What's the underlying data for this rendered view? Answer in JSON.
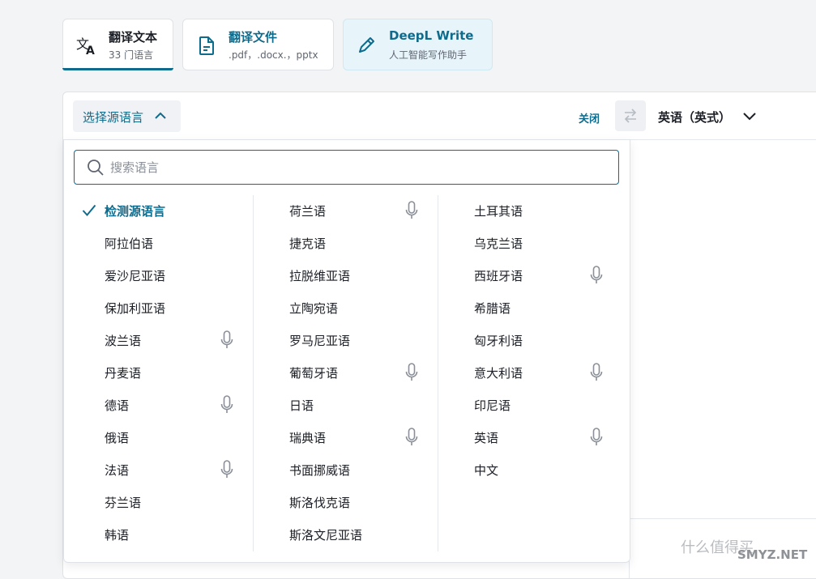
{
  "tabs": [
    {
      "title": "翻译文本",
      "subtitle": "33 门语言",
      "icon": "translate-icon"
    },
    {
      "title": "翻译文件",
      "subtitle": ".pdf，.docx.，pptx",
      "icon": "document-icon"
    },
    {
      "title": "DeepL Write",
      "subtitle": "人工智能写作助手",
      "icon": "pen-icon"
    }
  ],
  "toolbar": {
    "source_button": "选择源语言",
    "close_label": "关闭",
    "target_language": "英语（英式）"
  },
  "search": {
    "placeholder": "搜索语言",
    "value": ""
  },
  "languages": {
    "col1": [
      {
        "label": "检测源语言",
        "selected": true,
        "mic": false
      },
      {
        "label": "阿拉伯语",
        "mic": false
      },
      {
        "label": "爱沙尼亚语",
        "mic": false
      },
      {
        "label": "保加利亚语",
        "mic": false
      },
      {
        "label": "波兰语",
        "mic": true
      },
      {
        "label": "丹麦语",
        "mic": false
      },
      {
        "label": "德语",
        "mic": true
      },
      {
        "label": "俄语",
        "mic": false
      },
      {
        "label": "法语",
        "mic": true
      },
      {
        "label": "芬兰语",
        "mic": false
      },
      {
        "label": "韩语",
        "mic": false
      }
    ],
    "col2": [
      {
        "label": "荷兰语",
        "mic": true
      },
      {
        "label": "捷克语",
        "mic": false
      },
      {
        "label": "拉脱维亚语",
        "mic": false
      },
      {
        "label": "立陶宛语",
        "mic": false
      },
      {
        "label": "罗马尼亚语",
        "mic": false
      },
      {
        "label": "葡萄牙语",
        "mic": true
      },
      {
        "label": "日语",
        "mic": false
      },
      {
        "label": "瑞典语",
        "mic": true
      },
      {
        "label": "书面挪威语",
        "mic": false
      },
      {
        "label": "斯洛伐克语",
        "mic": false
      },
      {
        "label": "斯洛文尼亚语",
        "mic": false
      }
    ],
    "col3": [
      {
        "label": "土耳其语",
        "mic": false
      },
      {
        "label": "乌克兰语",
        "mic": false
      },
      {
        "label": "西班牙语",
        "mic": true
      },
      {
        "label": "希腊语",
        "mic": false
      },
      {
        "label": "匈牙利语",
        "mic": false
      },
      {
        "label": "意大利语",
        "mic": true
      },
      {
        "label": "印尼语",
        "mic": false
      },
      {
        "label": "英语",
        "mic": true
      },
      {
        "label": "中文",
        "mic": false
      }
    ]
  },
  "watermark": {
    "text": "什么值得买",
    "site": "SMYZ.NET"
  },
  "colors": {
    "accent": "#0f6b8c",
    "text": "#1b1e25",
    "muted": "#5f6570",
    "border": "#dfe3e8"
  }
}
